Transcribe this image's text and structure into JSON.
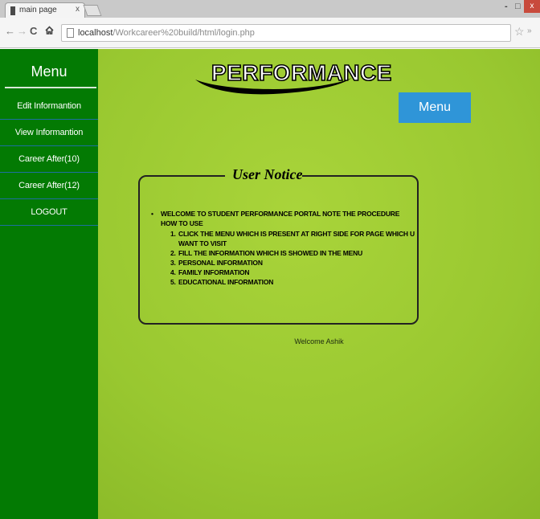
{
  "browser": {
    "tab_title": "main page",
    "tab_close": "x",
    "url_host": "localhost",
    "url_path": "/Workcareer%20build/html/login.php",
    "window_controls": {
      "minimize": "-",
      "maximize": "□",
      "close": "x"
    }
  },
  "sidebar": {
    "title": "Menu",
    "items": [
      {
        "label": "Edit Informantion"
      },
      {
        "label": "View Informantion"
      },
      {
        "label": "Career After(10)"
      },
      {
        "label": "Career After(12)"
      },
      {
        "label": "LOGOUT"
      }
    ]
  },
  "header": {
    "title": "PERFORMANCE"
  },
  "menu_button": {
    "label": "Menu"
  },
  "notice": {
    "title": "User Notice",
    "intro": "Welcome to student performance portal note the procedure how to use",
    "steps": [
      {
        "num": "1.",
        "text": "Click the menu which is present at right side for page which u want to visit"
      },
      {
        "num": "2.",
        "text": "fill the information which is showed in the menu"
      },
      {
        "num": "3.",
        "text": "personal information"
      },
      {
        "num": "4.",
        "text": "family information"
      },
      {
        "num": "5.",
        "text": "Educational information"
      }
    ]
  },
  "welcome_text": "Welcome Ashik",
  "colors": {
    "sidebar": "#037a03",
    "page_bg": "#9ccb32",
    "menu_button": "#2f95d8",
    "window_close": "#c84a3c"
  },
  "icons": {
    "back": "back-arrow-icon",
    "forward": "forward-arrow-icon",
    "reload": "reload-icon",
    "home": "home-icon",
    "bookmark": "star-icon",
    "page": "page-icon"
  }
}
